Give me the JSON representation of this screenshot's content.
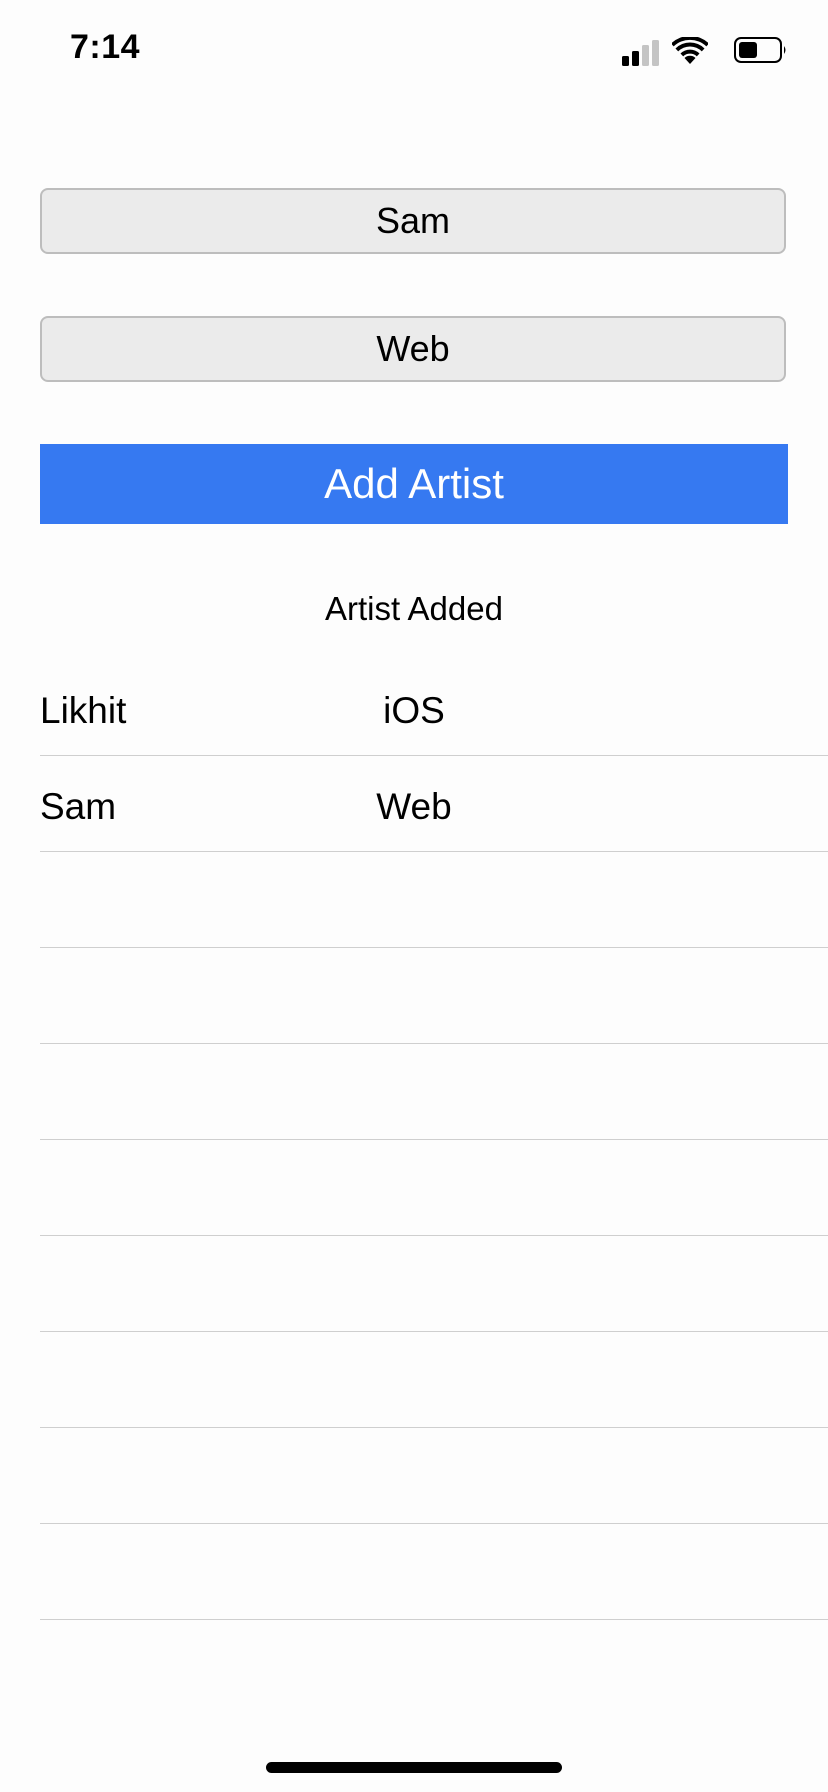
{
  "status_bar": {
    "time": "7:14",
    "icons": [
      "cellular-signal-icon",
      "wifi-icon",
      "battery-icon"
    ]
  },
  "form": {
    "name_value": "Sam",
    "platform_value": "Web",
    "add_button_label": "Add Artist",
    "status_message": "Artist Added"
  },
  "artists": [
    {
      "name": "Likhit",
      "platform": "iOS"
    },
    {
      "name": "Sam",
      "platform": "Web"
    },
    {
      "name": "",
      "platform": ""
    },
    {
      "name": "",
      "platform": ""
    },
    {
      "name": "",
      "platform": ""
    },
    {
      "name": "",
      "platform": ""
    },
    {
      "name": "",
      "platform": ""
    },
    {
      "name": "",
      "platform": ""
    },
    {
      "name": "",
      "platform": ""
    },
    {
      "name": "",
      "platform": ""
    }
  ],
  "colors": {
    "accent": "#3679f1",
    "field_background": "#ebebeb",
    "field_border": "#bdbdbd",
    "separator": "#cfcfcf"
  }
}
